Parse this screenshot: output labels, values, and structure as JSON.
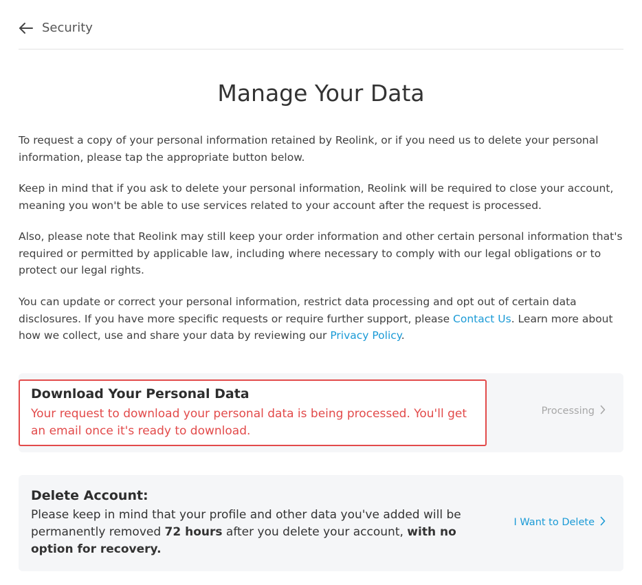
{
  "header": {
    "back_label": "Security"
  },
  "page": {
    "title": "Manage Your Data",
    "paragraphs": {
      "p1": "To request a copy of your personal information retained by Reolink, or if you need us to delete your personal information, please tap the appropriate button below.",
      "p2": "Keep in mind that if you ask to delete your personal information, Reolink will be required to close your account, meaning you won't be able to use services related to your account after the request is processed.",
      "p3": "Also, please note that Reolink may still keep your order information and other certain personal information that's required or permitted by applicable law, including where necessary to comply with our legal obligations or to protect our legal rights.",
      "p4_part1": "You can update or correct your personal information, restrict data processing and opt out of certain data disclosures. If you have more specific requests or require further support, please ",
      "p4_link1": "Contact Us",
      "p4_part2": ". Learn more about how we collect, use and share your data by reviewing our ",
      "p4_link2": "Privacy Policy",
      "p4_part3": "."
    }
  },
  "download_card": {
    "title": "Download Your Personal Data",
    "description": "Your request to download your personal data is being processed. You'll get an email once it's ready to download.",
    "action_label": "Processing",
    "action_icon": "chevron-right-icon"
  },
  "delete_card": {
    "title": "Delete Account:",
    "desc_part1": "Please keep in mind that your profile and other data you've added will be permanently removed ",
    "desc_bold1": "72 hours",
    "desc_part2": " after you delete your account, ",
    "desc_bold2": "with no option for recovery.",
    "action_label": "I Want to Delete",
    "action_icon": "chevron-right-icon"
  },
  "colors": {
    "accent": "#1a9ad6",
    "alert": "#e24a4a",
    "card_bg": "#f5f6f8"
  }
}
